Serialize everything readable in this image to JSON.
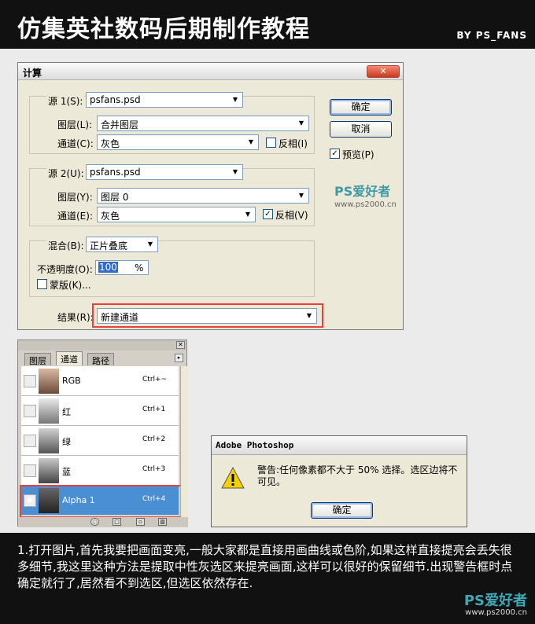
{
  "header": {
    "title": "仿集英社数码后期制作教程",
    "by": "BY PS_FANS"
  },
  "dialog": {
    "title": "计算",
    "close_label": "✕",
    "source1": {
      "label": "源 1(S):",
      "file": "psfans.psd",
      "layer_label": "图层(L):",
      "layer": "合并图层",
      "channel_label": "通道(C):",
      "channel": "灰色",
      "invert_label": "反相(I)",
      "invert_checked": false
    },
    "source2": {
      "label": "源 2(U):",
      "file": "psfans.psd",
      "layer_label": "图层(Y):",
      "layer": "图层 0",
      "channel_label": "通道(E):",
      "channel": "灰色",
      "invert_label": "反相(V)",
      "invert_checked": true
    },
    "blending": {
      "label": "混合(B):",
      "mode": "正片叠底",
      "opacity_label": "不透明度(O):",
      "opacity": "100",
      "percent": "%",
      "mask_label": "蒙版(K)..."
    },
    "result": {
      "label": "结果(R):",
      "value": "新建通道"
    },
    "ok_label": "确定",
    "cancel_label": "取消",
    "preview_label": "预览(P)",
    "logo": "PS爱好者",
    "site": "www.ps2000.cn"
  },
  "channels_panel": {
    "tabs": [
      "图层",
      "通道",
      "路径"
    ],
    "rows": [
      {
        "name": "RGB",
        "shortcut": "Ctrl+~"
      },
      {
        "name": "红",
        "shortcut": "Ctrl+1"
      },
      {
        "name": "绿",
        "shortcut": "Ctrl+2"
      },
      {
        "name": "蓝",
        "shortcut": "Ctrl+3"
      },
      {
        "name": "Alpha 1",
        "shortcut": "Ctrl+4"
      }
    ]
  },
  "alert": {
    "title": "Adobe Photoshop",
    "message": "警告:任何像素都不大于 50% 选择。选区边将不可见。",
    "ok_label": "确定"
  },
  "caption": {
    "text": "1.打开图片,首先我要把画面变亮,一般大家都是直接用画曲线或色阶,如果这样直接提亮会丢失很多细节,我这里这种方法是提取中性灰选区来提亮画面,这样可以很好的保留细节.出现警告框时点确定就行了,居然看不到选区,但选区依然存在.",
    "logo": "PS爱好者",
    "site": "www.ps2000.cn"
  }
}
